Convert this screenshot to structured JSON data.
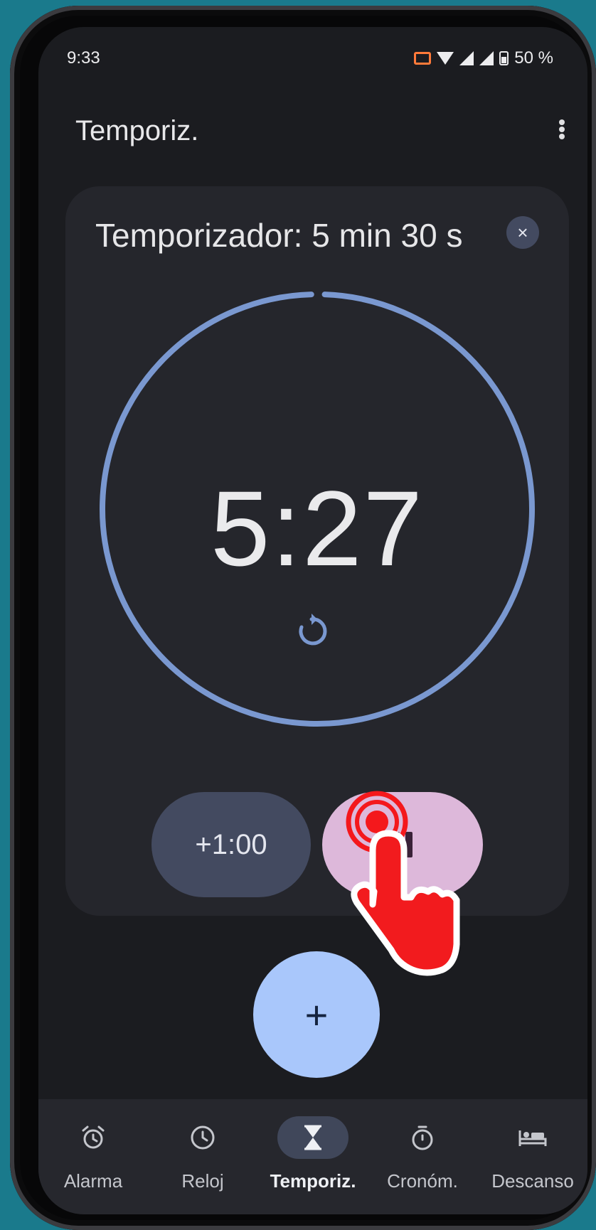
{
  "colors": {
    "background": "#1a7a8c",
    "screen": "#1b1c20",
    "card": "#25262c",
    "ring": "#7a98d0",
    "pause_button": "#ddb8da",
    "add_minute_button": "#434a60",
    "fab": "#a9c7fb",
    "nav_bar": "#26272d",
    "tap_indicator": "#f4181c"
  },
  "status_bar": {
    "time": "9:33",
    "battery": "50 %",
    "icons": [
      "cast-icon",
      "wifi-icon",
      "signal-icon",
      "signal-roaming-icon",
      "battery-icon"
    ]
  },
  "header": {
    "title": "Temporiz.",
    "menu_icon": "more-vert-icon"
  },
  "timer": {
    "label": "Temporizador: 5 min 30 s",
    "remaining": "5:27",
    "progress_remaining_fraction": 0.99,
    "close_label": "×",
    "reset_icon": "reset-icon"
  },
  "controls": {
    "add_minute_label": "+1:00",
    "pause_icon": "pause-icon"
  },
  "fab": {
    "label": "+"
  },
  "nav": {
    "items": [
      {
        "label": "Alarma",
        "icon": "alarm-icon",
        "active": false
      },
      {
        "label": "Reloj",
        "icon": "clock-icon",
        "active": false
      },
      {
        "label": "Temporiz.",
        "icon": "hourglass-icon",
        "active": true
      },
      {
        "label": "Cronóm.",
        "icon": "stopwatch-icon",
        "active": false
      },
      {
        "label": "Descanso",
        "icon": "bed-icon",
        "active": false
      }
    ]
  }
}
